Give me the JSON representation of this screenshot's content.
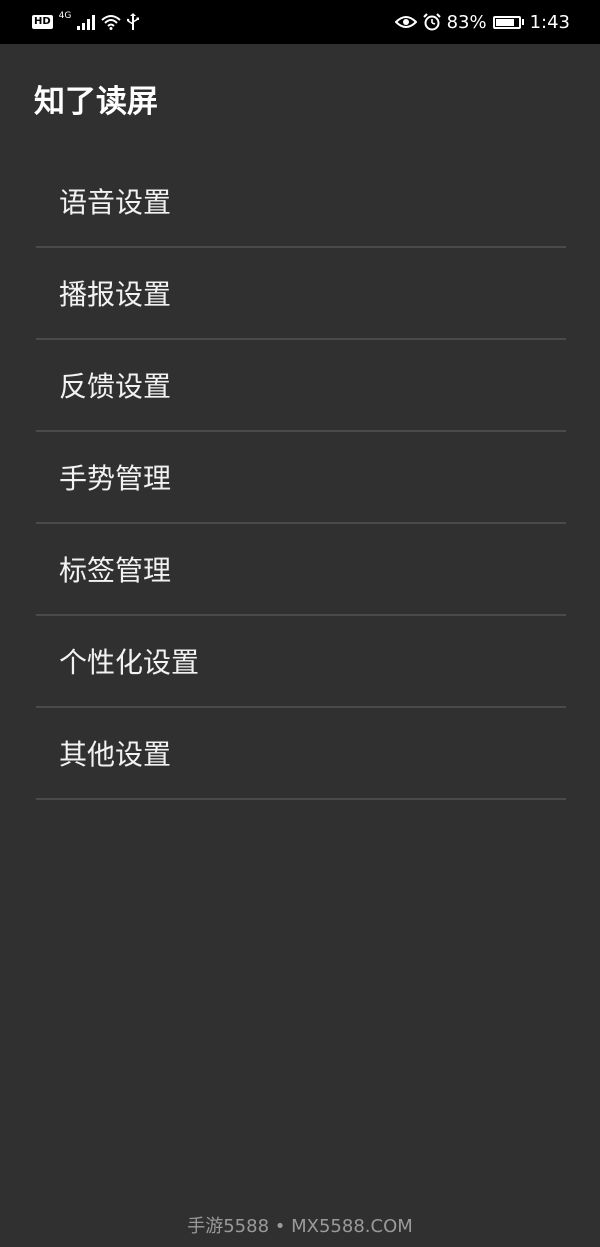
{
  "status_bar": {
    "hd_label": "HD",
    "network_label": "4G",
    "battery_percent": "83%",
    "battery_level": 0.83,
    "time": "1:43",
    "icons": [
      "hd-icon",
      "signal-icon",
      "wifi-icon",
      "usb-icon",
      "eye-icon",
      "alarm-icon",
      "battery-icon"
    ]
  },
  "app": {
    "title": "知了读屏"
  },
  "menu": {
    "items": [
      {
        "label": "语音设置"
      },
      {
        "label": "播报设置"
      },
      {
        "label": "反馈设置"
      },
      {
        "label": "手势管理"
      },
      {
        "label": "标签管理"
      },
      {
        "label": "个性化设置"
      },
      {
        "label": "其他设置"
      }
    ]
  },
  "watermark": {
    "text": "手游5588 • MX5588.COM"
  },
  "colors": {
    "background": "#303030",
    "status_bar": "#000000",
    "divider": "#4a4a4a",
    "text": "#ffffff"
  }
}
